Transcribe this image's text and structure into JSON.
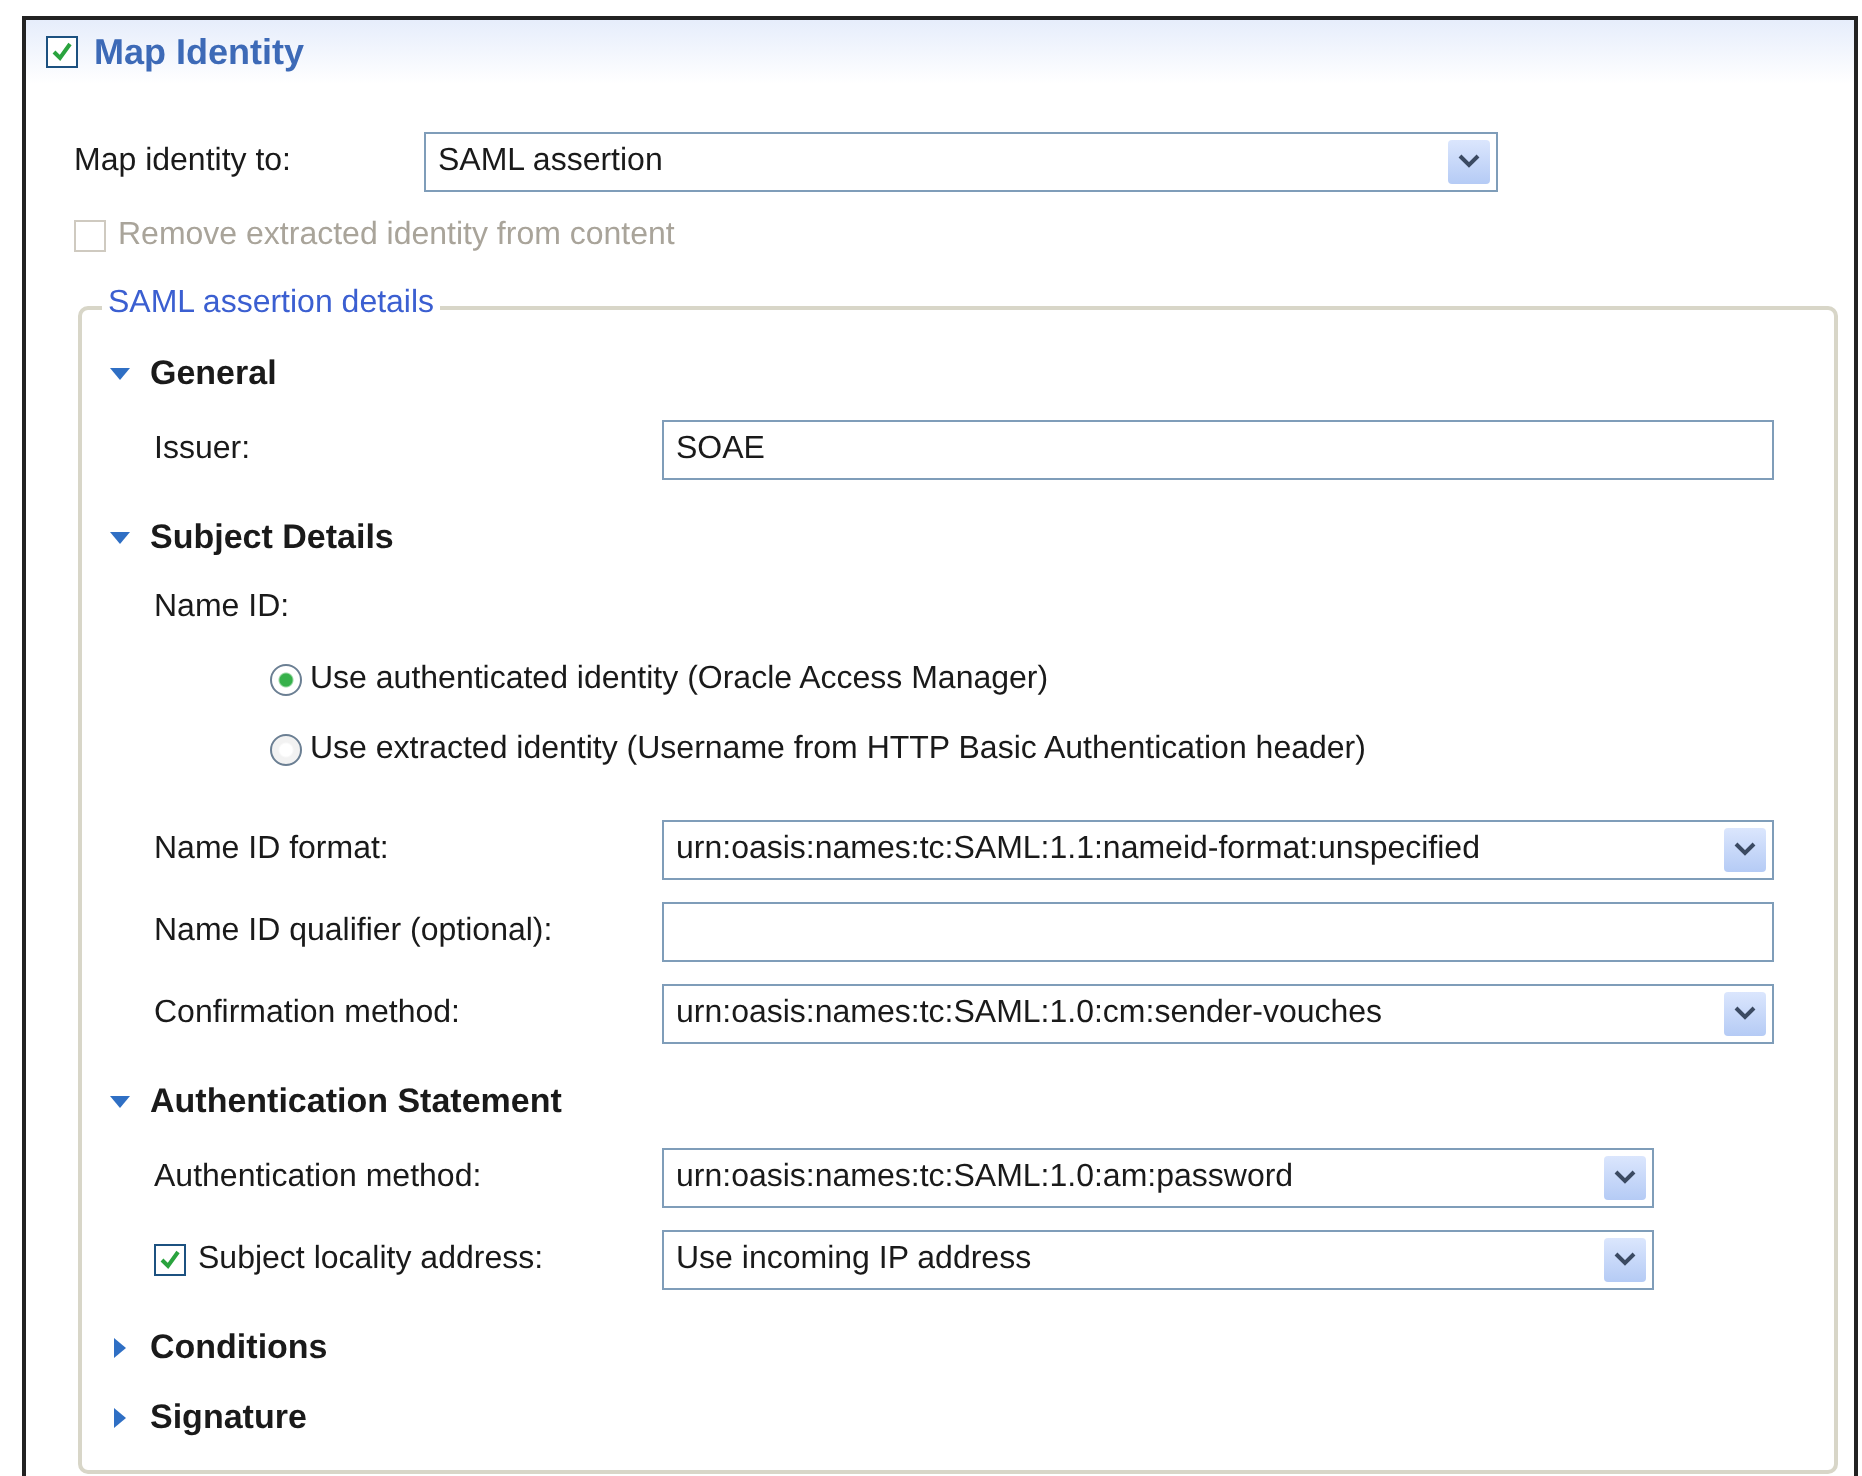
{
  "header": {
    "title": "Map Identity",
    "checked": true
  },
  "map_identity": {
    "label": "Map identity to:",
    "value": "SAML assertion"
  },
  "remove_option": {
    "label": "Remove extracted identity from content",
    "checked": false,
    "disabled": true
  },
  "group": {
    "legend": "SAML assertion details",
    "sections": [
      {
        "title": "General",
        "expanded": true,
        "rows": [
          {
            "kind": "text",
            "label": "Issuer:",
            "value": "SOAE"
          }
        ]
      },
      {
        "title": "Subject Details",
        "expanded": true,
        "rows": [
          {
            "kind": "radios",
            "label": "Name ID:",
            "options": [
              {
                "label": "Use authenticated identity (Oracle Access Manager)",
                "selected": true
              },
              {
                "label": "Use extracted identity (Username from HTTP Basic Authentication header)",
                "selected": false
              }
            ]
          },
          {
            "kind": "select",
            "label": "Name ID format:",
            "value": "urn:oasis:names:tc:SAML:1.1:nameid-format:unspecified"
          },
          {
            "kind": "text",
            "label": "Name ID qualifier (optional):",
            "value": ""
          },
          {
            "kind": "select",
            "label": "Confirmation method:",
            "value": "urn:oasis:names:tc:SAML:1.0:cm:sender-vouches"
          }
        ]
      },
      {
        "title": "Authentication Statement",
        "expanded": true,
        "rows": [
          {
            "kind": "select",
            "label": "Authentication method:",
            "value": "urn:oasis:names:tc:SAML:1.0:am:password"
          },
          {
            "kind": "check-select",
            "label": "Subject locality address:",
            "checked": true,
            "value": "Use incoming IP address"
          }
        ]
      },
      {
        "title": "Conditions",
        "expanded": false
      },
      {
        "title": "Signature",
        "expanded": false
      }
    ]
  }
}
